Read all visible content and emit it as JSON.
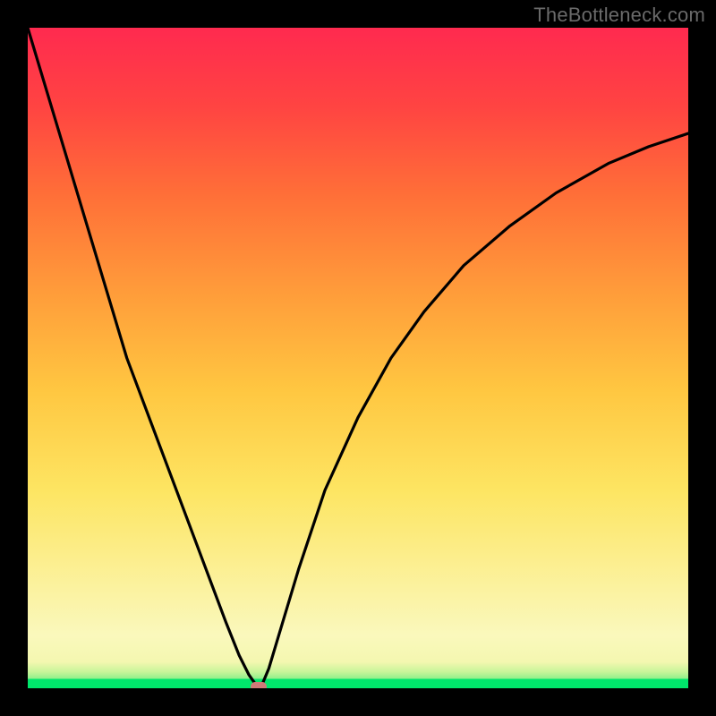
{
  "watermark": "TheBottleneck.com",
  "chart_data": {
    "type": "line",
    "title": "",
    "xlabel": "",
    "ylabel": "",
    "xlim": [
      0,
      100
    ],
    "ylim": [
      0,
      100
    ],
    "x": [
      0,
      3,
      6,
      9,
      12,
      15,
      18,
      21,
      24,
      27,
      30,
      32,
      33.5,
      34.5,
      35,
      35.5,
      36.5,
      38,
      41,
      45,
      50,
      55,
      60,
      66,
      73,
      80,
      88,
      94,
      100
    ],
    "values": [
      100,
      90,
      80,
      70,
      60,
      50,
      42,
      34,
      26,
      18,
      10,
      5,
      2,
      0.6,
      0,
      0.6,
      3,
      8,
      18,
      30,
      41,
      50,
      57,
      64,
      70,
      75,
      79.5,
      82,
      84
    ],
    "marker": {
      "x": 35,
      "y": 0,
      "color": "#cf7a78"
    },
    "background_gradient": {
      "direction": "vertical",
      "stops": [
        {
          "pos": 0.0,
          "color": "#ff2a4f"
        },
        {
          "pos": 0.12,
          "color": "#ff4442"
        },
        {
          "pos": 0.25,
          "color": "#ff6e38"
        },
        {
          "pos": 0.4,
          "color": "#ff9c3a"
        },
        {
          "pos": 0.55,
          "color": "#ffc741"
        },
        {
          "pos": 0.7,
          "color": "#fde562"
        },
        {
          "pos": 0.86,
          "color": "#fbf3a4"
        },
        {
          "pos": 0.92,
          "color": "#faf8bc"
        },
        {
          "pos": 0.96,
          "color": "#f4f7b0"
        },
        {
          "pos": 0.986,
          "color": "#8fef8a"
        },
        {
          "pos": 1.0,
          "color": "#00e66b"
        }
      ]
    }
  }
}
